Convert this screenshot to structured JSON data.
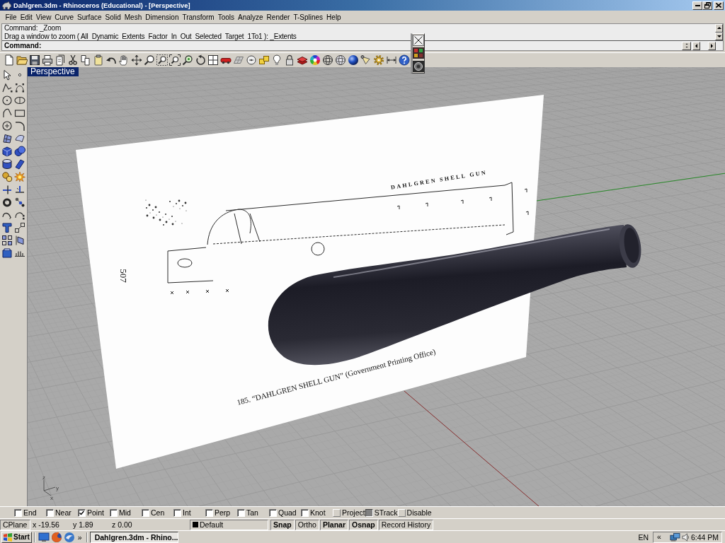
{
  "window": {
    "title": "Dahlgren.3dm - Rhinoceros (Educational) - [Perspective]"
  },
  "menu": [
    "File",
    "Edit",
    "View",
    "Curve",
    "Surface",
    "Solid",
    "Mesh",
    "Dimension",
    "Transform",
    "Tools",
    "Analyze",
    "Render",
    "T-Splines",
    "Help"
  ],
  "command_history": [
    "Command: _Zoom",
    "Drag a window to zoom ( All  Dynamic  Extents  Factor  In  Out  Selected  Target  1To1 ): _Extents"
  ],
  "command_prompt": "Command:",
  "viewport": {
    "tab": "Perspective",
    "reference_image": {
      "title": "DAHLGREN SHELL GUN",
      "page_number": "507",
      "caption": "185. “DAHLGREN SHELL GUN” (Government Printing Office)"
    },
    "axis_labels": [
      "z",
      "y",
      "x"
    ]
  },
  "osnaps": [
    {
      "label": "End",
      "checked": false,
      "kind": "checkbox"
    },
    {
      "label": "Near",
      "checked": false,
      "kind": "checkbox"
    },
    {
      "label": "Point",
      "checked": true,
      "kind": "checkbox"
    },
    {
      "label": "Mid",
      "checked": false,
      "kind": "checkbox"
    },
    {
      "label": "Cen",
      "checked": false,
      "kind": "checkbox"
    },
    {
      "label": "Int",
      "checked": false,
      "kind": "checkbox"
    },
    {
      "label": "Perp",
      "checked": false,
      "kind": "checkbox"
    },
    {
      "label": "Tan",
      "checked": false,
      "kind": "checkbox"
    },
    {
      "label": "Quad",
      "checked": false,
      "kind": "checkbox"
    },
    {
      "label": "Knot",
      "checked": false,
      "kind": "checkbox"
    },
    {
      "label": "Project",
      "checked": false,
      "kind": "toggle"
    },
    {
      "label": "STrack",
      "checked": true,
      "kind": "toggle"
    },
    {
      "label": "Disable",
      "checked": false,
      "kind": "toggle"
    }
  ],
  "status_bar": {
    "cplane": "CPlane",
    "x": "x -19.56",
    "y": "y 1.89",
    "z": "z 0.00",
    "layer": "Default",
    "panes": [
      {
        "label": "Snap",
        "on": true
      },
      {
        "label": "Ortho",
        "on": false
      },
      {
        "label": "Planar",
        "on": true
      },
      {
        "label": "Osnap",
        "on": true
      },
      {
        "label": "Record History",
        "on": false
      }
    ]
  },
  "taskbar": {
    "start": "Start",
    "more": "»",
    "tasks": [
      {
        "label": "Dahlgren.3dm - Rhino...",
        "selected": true
      }
    ],
    "language": "EN",
    "tray_expand": "«",
    "clock": "6:44 PM"
  }
}
